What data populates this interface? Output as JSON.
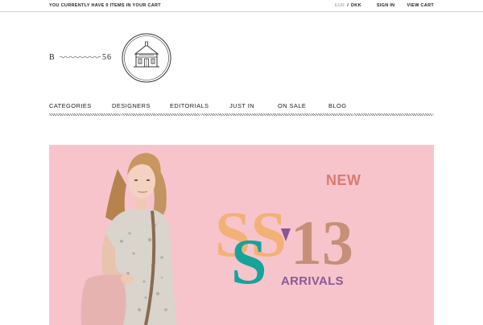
{
  "topbar": {
    "cart_message": "YOU CURRENTLY HAVE 0 ITEMS IN YOUR CART",
    "currency_eur": "EUR",
    "currency_sep": "/",
    "currency_dkk": "DKK",
    "sign_in": "SIGN IN",
    "view_cart": "VIEW CART"
  },
  "logo": {
    "left": "B",
    "right": "56"
  },
  "nav": {
    "items": [
      "CATEGORIES",
      "DESIGNERS",
      "EDITORIALS",
      "JUST IN",
      "ON SALE",
      "BLOG"
    ]
  },
  "hero": {
    "new": "NEW",
    "season": "SS",
    "year": "13",
    "arrivals": "ARRIVALS",
    "bg_color": "#f7c4cc"
  }
}
